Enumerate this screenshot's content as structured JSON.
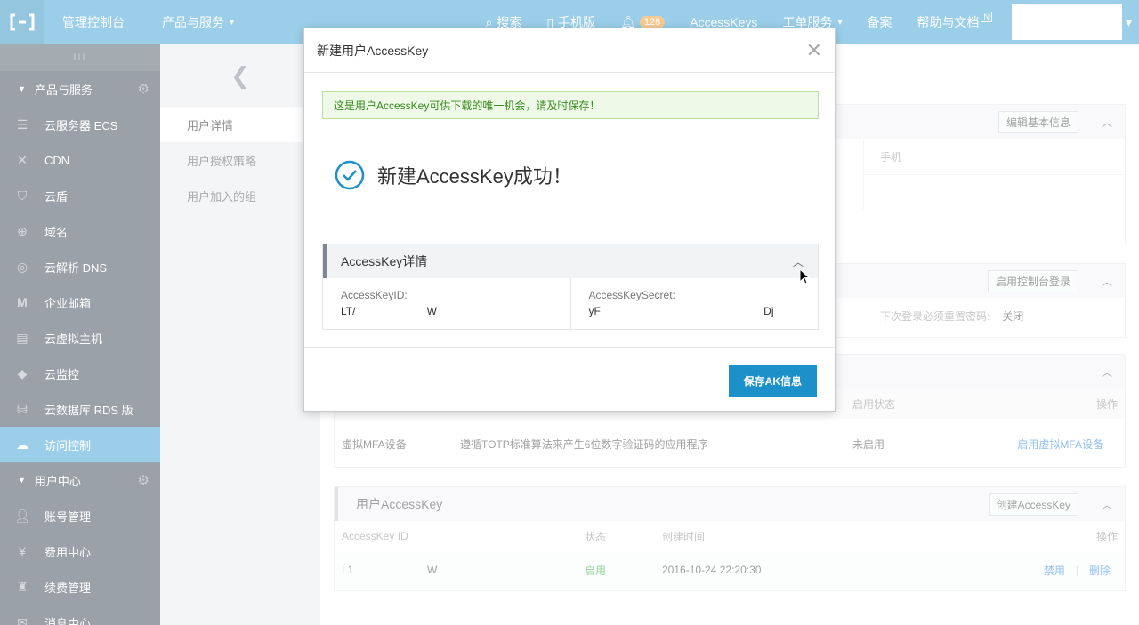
{
  "topbar": {
    "logo_icon": "aliyun-logo-icon",
    "console_title": "管理控制台",
    "products_menu": "产品与服务",
    "search": "搜索",
    "mobile": "手机版",
    "notifications_count": "128",
    "accesskeys": "AccessKeys",
    "tickets": "工单服务",
    "beian": "备案",
    "help": "帮助与文档",
    "help_badge": "N"
  },
  "sidebar": {
    "collapse_glyph": "III",
    "products_section": "产品与服务",
    "products": [
      {
        "label": "云服务器 ECS",
        "icon": "server-icon"
      },
      {
        "label": "CDN",
        "icon": "cdn-icon"
      },
      {
        "label": "云盾",
        "icon": "shield-icon"
      },
      {
        "label": "域名",
        "icon": "globe-icon"
      },
      {
        "label": "云解析 DNS",
        "icon": "dns-icon"
      },
      {
        "label": "企业邮箱",
        "icon": "mail-m-icon"
      },
      {
        "label": "云虚拟主机",
        "icon": "host-icon"
      },
      {
        "label": "云监控",
        "icon": "monitor-icon"
      },
      {
        "label": "云数据库 RDS 版",
        "icon": "database-icon"
      },
      {
        "label": "访问控制",
        "icon": "cloud-icon"
      }
    ],
    "user_section": "用户中心",
    "user_items": [
      {
        "label": "账号管理",
        "icon": "user-icon"
      },
      {
        "label": "费用中心",
        "icon": "yen-icon"
      },
      {
        "label": "续费管理",
        "icon": "renew-icon"
      },
      {
        "label": "消息中心",
        "icon": "message-icon"
      }
    ]
  },
  "subnav": {
    "items": [
      "用户详情",
      "用户授权策略",
      "用户加入的组"
    ]
  },
  "main": {
    "basic": {
      "edit_button": "编辑基本信息",
      "phone_label": "手机"
    },
    "login": {
      "enable_button": "启用控制台登录",
      "reset_label": "下次登录必须重置密码:",
      "reset_value": "关闭"
    },
    "mfa": {
      "col_status": "启用状态",
      "col_action": "操作",
      "row": {
        "name": "虚拟MFA设备",
        "desc": "遵循TOTP标准算法来产生6位数字验证码的应用程序",
        "status": "未启用",
        "action": "启用虚拟MFA设备"
      }
    },
    "accesskey": {
      "title": "用户AccessKey",
      "create_button": "创建AccessKey",
      "col_id": "AccessKey ID",
      "col_status": "状态",
      "col_created": "创建时间",
      "col_action": "操作",
      "row": {
        "id_start": "L1",
        "id_end": "W",
        "status": "启用",
        "created": "2016-10-24 22:20:30",
        "disable": "禁用",
        "sep": "|",
        "delete": "删除"
      }
    }
  },
  "modal": {
    "title": "新建用户AccessKey",
    "alert": "这是用户AccessKey可供下载的唯一机会，请及时保存！",
    "success": "新建AccessKey成功！",
    "details_title": "AccessKey详情",
    "id_label": "AccessKeyID:",
    "id_start": "LT/",
    "id_end": "W",
    "secret_label": "AccessKeySecret:",
    "secret_start": "yF",
    "secret_end": "Dj",
    "save_button": "保存AK信息"
  },
  "colors": {
    "topbar": "#49a8d8",
    "sidebar": "#4a5561",
    "primary_button": "#1c90c8",
    "success_icon": "#1c90c8"
  }
}
